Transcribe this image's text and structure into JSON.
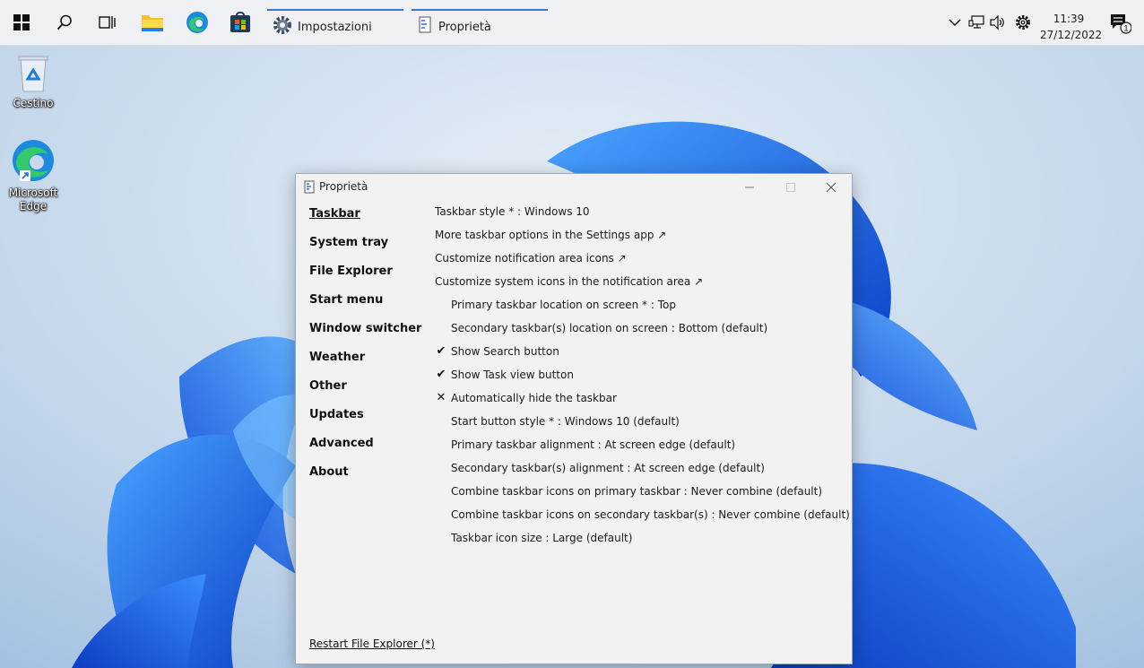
{
  "taskbar": {
    "apps": [
      {
        "label": "Impostazioni",
        "icon": "settings-gear-icon"
      },
      {
        "label": "Proprietà",
        "icon": "properties-icon"
      }
    ],
    "clock": {
      "time": "11:39",
      "date": "27/12/2022"
    },
    "notification_count": "1"
  },
  "desktop": {
    "icons": [
      {
        "label": "Cestino",
        "icon": "recycle-bin-icon"
      },
      {
        "label": "Microsoft Edge",
        "icon": "edge-icon"
      }
    ]
  },
  "dialog": {
    "title": "Proprietà",
    "nav": [
      "Taskbar",
      "System tray",
      "File Explorer",
      "Start menu",
      "Window switcher",
      "Weather",
      "Other",
      "Updates",
      "Advanced",
      "About"
    ],
    "active_nav": "Taskbar",
    "options": [
      {
        "text": "Taskbar style * : Windows 10",
        "mark": ""
      },
      {
        "text": "More taskbar options in the Settings app ↗",
        "mark": ""
      },
      {
        "text": "Customize notification area icons ↗",
        "mark": ""
      },
      {
        "text": "Customize system icons in the notification area ↗",
        "mark": ""
      },
      {
        "text": "Primary taskbar location on screen * : Top",
        "mark": ""
      },
      {
        "text": "Secondary taskbar(s) location on screen : Bottom (default)",
        "mark": ""
      },
      {
        "text": "Show Search button",
        "mark": "✔"
      },
      {
        "text": "Show Task view button",
        "mark": "✔"
      },
      {
        "text": "Automatically hide the taskbar",
        "mark": "✕"
      },
      {
        "text": "Start button style * : Windows 10 (default)",
        "mark": ""
      },
      {
        "text": "Primary taskbar alignment : At screen edge (default)",
        "mark": ""
      },
      {
        "text": "Secondary taskbar(s) alignment : At screen edge (default)",
        "mark": ""
      },
      {
        "text": "Combine taskbar icons on primary taskbar : Never combine (default)",
        "mark": ""
      },
      {
        "text": "Combine taskbar icons on secondary taskbar(s) : Never combine (default)",
        "mark": ""
      },
      {
        "text": "Taskbar icon size : Large (default)",
        "mark": ""
      }
    ],
    "restart_label": "Restart File Explorer (*)"
  },
  "colors": {
    "accent": "#3b78d6",
    "wallpaper_blue": "#1d5fe0"
  }
}
